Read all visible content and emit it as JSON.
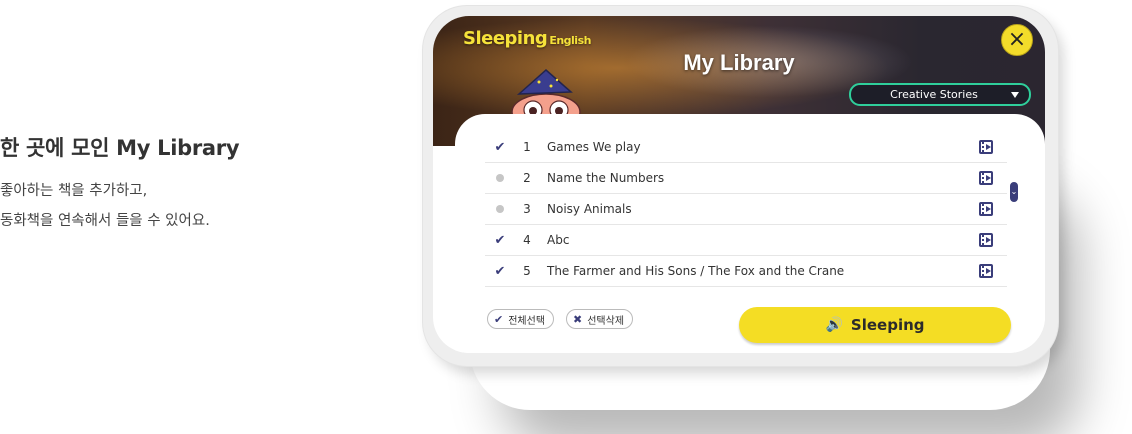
{
  "intro": {
    "title": "한 곳에 모인 My Library",
    "line1": "좋아하는 책을 추가하고,",
    "line2": "동화책을 연속해서 들을 수 있어요."
  },
  "app": {
    "logo_main": "Sleeping",
    "logo_sub": "English",
    "title": "My Library",
    "close_icon": "×",
    "category_selected": "Creative Stories"
  },
  "items": [
    {
      "num": "1",
      "title": "Games We play",
      "checked": true
    },
    {
      "num": "2",
      "title": "Name the Numbers",
      "checked": false
    },
    {
      "num": "3",
      "title": "Noisy Animals",
      "checked": false
    },
    {
      "num": "4",
      "title": "Abc",
      "checked": true
    },
    {
      "num": "5",
      "title": "The Farmer and His Sons / The Fox and the Crane",
      "checked": true
    }
  ],
  "actions": {
    "select_all": "전체선택",
    "delete_selected": "선택삭제",
    "sleeping": "Sleeping"
  },
  "colors": {
    "accent_yellow": "#f4dd24",
    "accent_navy": "#3a3d7a",
    "category_border": "#2fcf9b"
  }
}
